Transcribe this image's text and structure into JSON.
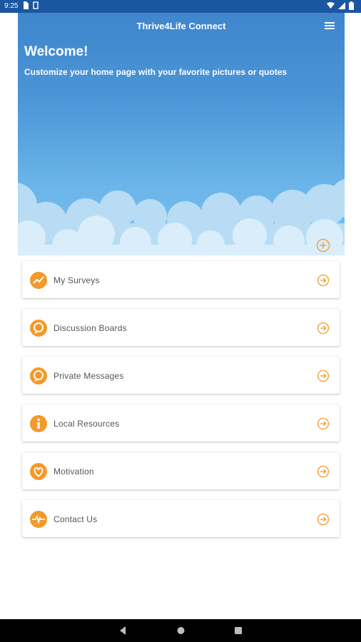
{
  "status_bar": {
    "time": "9:25"
  },
  "header": {
    "app_title": "Thrive4Life Connect",
    "welcome": "Welcome!",
    "subtitle": "Customize your home page with your favorite pictures or quotes"
  },
  "accent_color": "#f39a2b",
  "menu": {
    "items": [
      {
        "label": "My Surveys",
        "icon": "chart-line-icon"
      },
      {
        "label": "Discussion Boards",
        "icon": "chat-bubble-icon"
      },
      {
        "label": "Private Messages",
        "icon": "message-icon"
      },
      {
        "label": "Local Resources",
        "icon": "info-icon"
      },
      {
        "label": "Motivation",
        "icon": "heart-icon"
      },
      {
        "label": "Contact Us",
        "icon": "heartbeat-icon"
      }
    ]
  }
}
